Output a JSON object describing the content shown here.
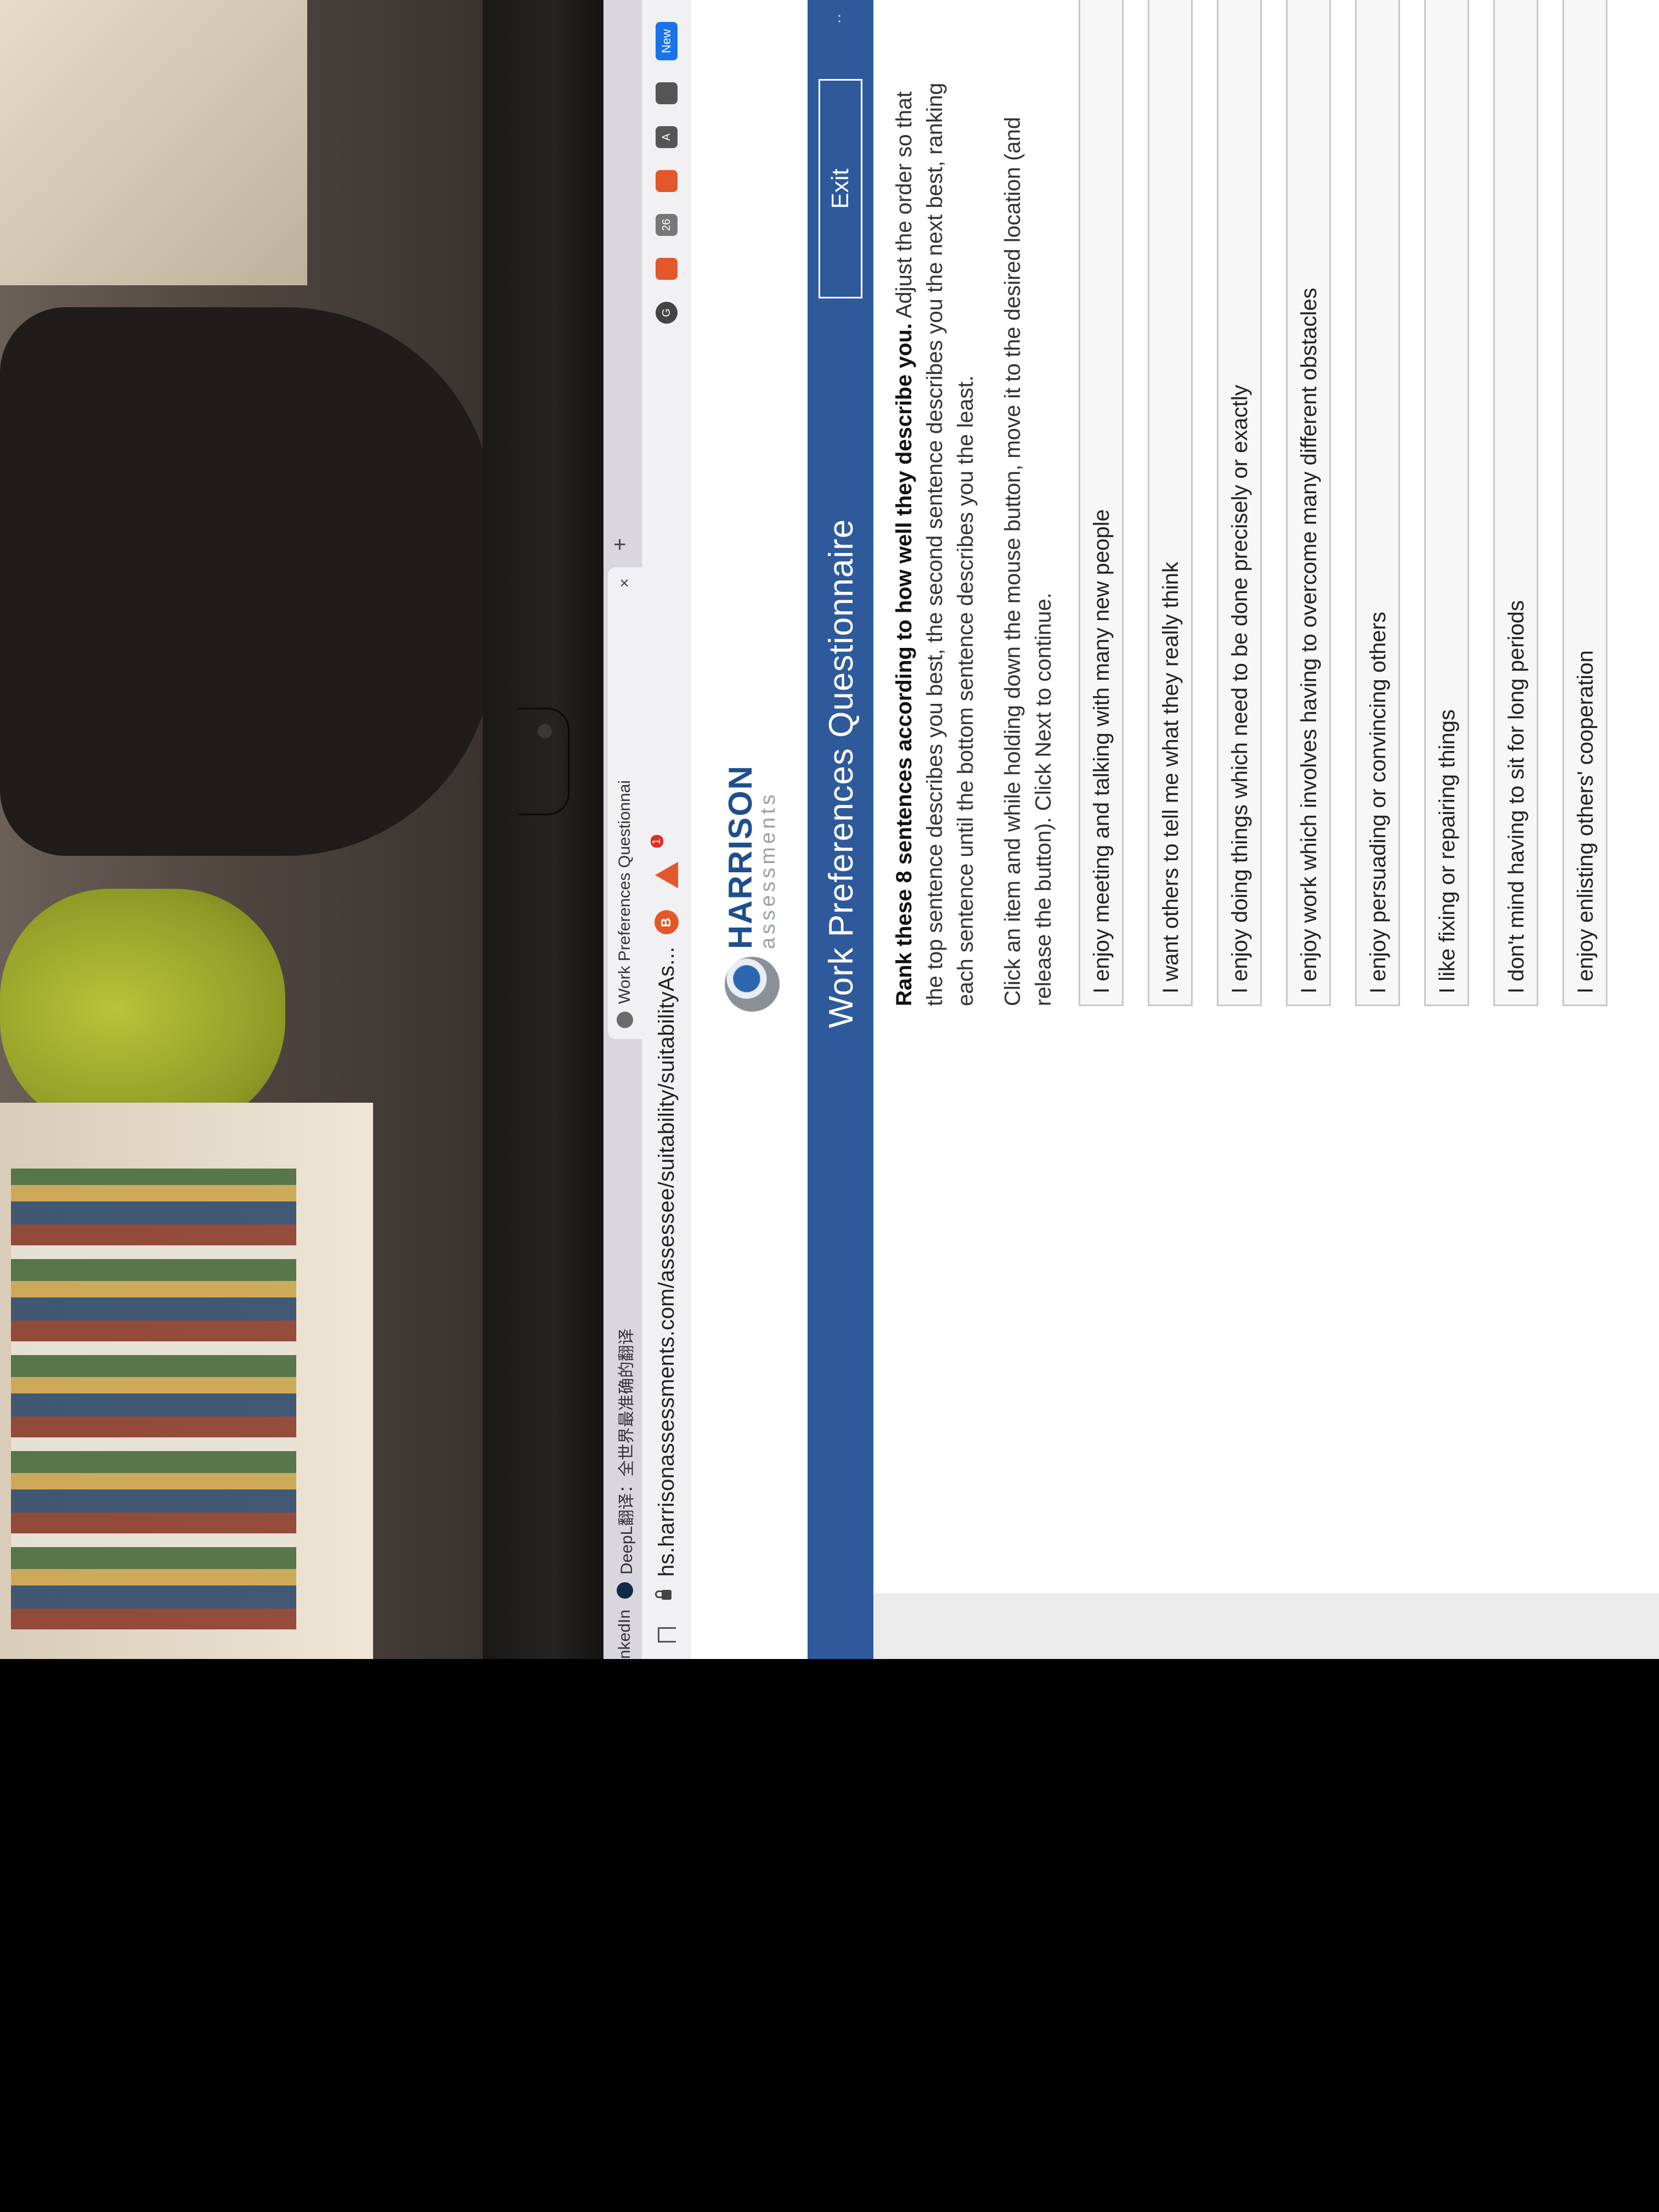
{
  "browser": {
    "tabs": [
      {
        "label": "nkedIn",
        "active": false
      },
      {
        "label": "DeepL翻译：全世界最准确的翻译",
        "active": false
      },
      {
        "label": "Work Preferences Questionnai",
        "active": true
      }
    ],
    "new_tab_label": "+",
    "tab_close_label": "×",
    "url": "hs.harrisonassessments.com/assessee/suitability/suitabilityAs...",
    "extensions": [
      {
        "icon": "brave-shield-icon"
      },
      {
        "icon": "brave-rewards-icon",
        "badge": "1"
      }
    ],
    "toolbar_icons": [
      {
        "icon": "grammarly-icon",
        "label": "G"
      },
      {
        "icon": "extension-icon",
        "label": ""
      },
      {
        "icon": "counter-icon",
        "label": "26"
      },
      {
        "icon": "pocket-icon",
        "label": ""
      },
      {
        "icon": "reader-icon",
        "label": "A"
      },
      {
        "icon": "profiles-icon",
        "label": ""
      },
      {
        "icon": "new-feature-icon",
        "label": "New"
      }
    ]
  },
  "brand": {
    "name": "HARRISON",
    "sub": "assessments"
  },
  "banner": {
    "title": "Work Preferences Questionnaire",
    "exit_label": "Exit",
    "dots": "··"
  },
  "instructions": {
    "bold": "Rank these 8 sentences according to how well they describe you.",
    "rest": " Adjust the order so that the top sentence describes you best, the second sentence describes you the next best, ranking each sentence until the bottom sentence describes you the least.",
    "drag_hint": "Click an item and while holding down the mouse button, move it to the desired location (and release the button). Click Next to continue."
  },
  "items": [
    "I enjoy meeting and talking with many new people",
    "I want others to tell me what they really think",
    "I enjoy doing things which need to be done precisely or exactly",
    "I enjoy work which involves having to overcome many different obstacles",
    "I enjoy persuading or convincing others",
    "I like fixing or repairing things",
    "I don't mind having to sit for long periods",
    "I enjoy enlisting others' cooperation"
  ],
  "colors": {
    "banner": "#2e5a9c",
    "brand": "#1f4e8c"
  }
}
